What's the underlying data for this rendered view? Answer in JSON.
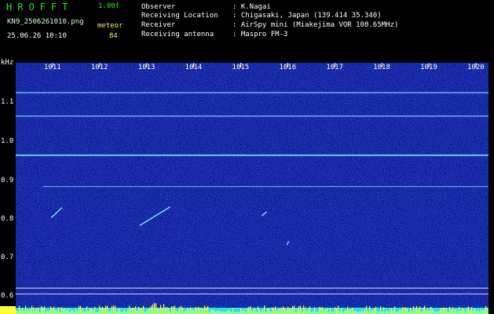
{
  "app": {
    "title_letters": "HROFFT",
    "version": "1.00f"
  },
  "file": {
    "filename": "KN9_2506261010.png",
    "timestamp": "25.06.26 10:10"
  },
  "meteor": {
    "label": "meteor",
    "count": "84"
  },
  "station": {
    "observer_label": "Observer",
    "observer_value": ": K.Nagai",
    "location_label": "Receiving Location",
    "location_value": ": Chigasaki, Japan (139.414 35.340)",
    "receiver_label": "Receiver",
    "receiver_value": ": AirSpy mini (Miakejima VOR 108.65MHz)",
    "antenna_label": "Receiving antenna",
    "antenna_value": ": Maspro FM-3"
  },
  "axes": {
    "y_unit": "kHz",
    "y_ticks": [
      "1.1",
      "1.0",
      "0.9",
      "0.8",
      "0.7",
      "0.6"
    ],
    "x_ticks": [
      "1011",
      "1012",
      "1013",
      "1014",
      "1015",
      "1016",
      "1017",
      "1018",
      "1019",
      "1020"
    ]
  },
  "colors": {
    "background_noise": "#0f1f9e",
    "carrier_line": "#7ff0ff",
    "header_green": "#29e629",
    "meteor_label": "#f0f070",
    "level_bar_cyan": "#19e6ff",
    "level_bar_yellow": "#ffff33"
  },
  "spectrogram": {
    "carrier_freqs_khz": [
      1.12,
      1.06,
      0.96,
      0.88
    ],
    "reference_lines_khz": [
      0.62,
      0.605
    ],
    "meteor_traces": [
      {
        "x0": 1010.97,
        "y0": 0.8,
        "x1": 1011.2,
        "y1": 0.826
      },
      {
        "x0": 1012.85,
        "y0": 0.78,
        "x1": 1013.5,
        "y1": 0.828
      },
      {
        "x0": 1015.45,
        "y0": 0.805,
        "x1": 1015.55,
        "y1": 0.815
      },
      {
        "x0": 1015.98,
        "y0": 0.73,
        "x1": 1016.02,
        "y1": 0.74
      }
    ]
  }
}
